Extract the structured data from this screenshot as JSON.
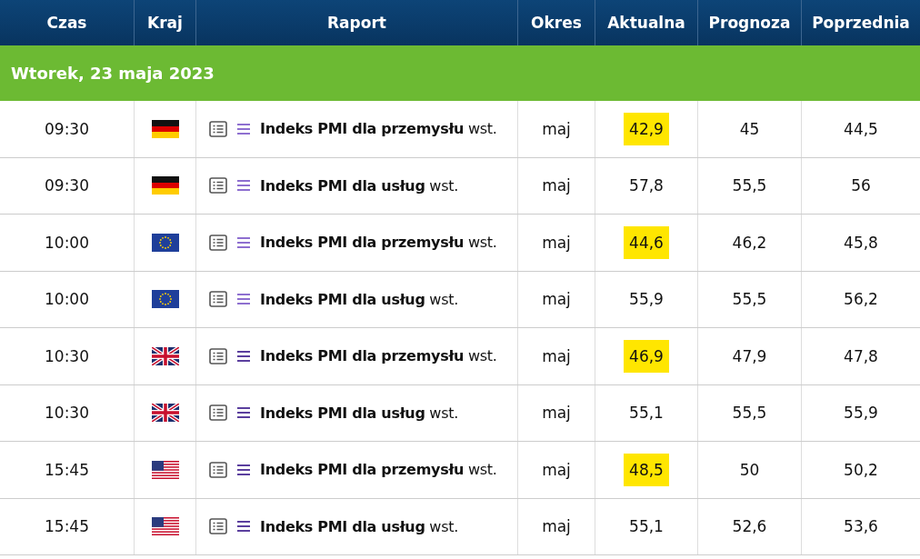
{
  "table": {
    "columns": [
      "Czas",
      "Kraj",
      "Raport",
      "Okres",
      "Aktualna",
      "Prognoza",
      "Poprzednia"
    ],
    "group_label": "Wtorek, 23 maja 2023",
    "rows": [
      {
        "time": "09:30",
        "kind": "de",
        "report": "**Indeks PMI dla przemysłu** wst.",
        "color": "#8e6fd0",
        "period": "maj",
        "actual": "42,9",
        "highlighted": true,
        "forecast": "45",
        "previous": "44,5"
      },
      {
        "time": "09:30",
        "kind": "de",
        "report": "**Indeks PMI dla usług** wst.",
        "color": "#8e6fd0",
        "period": "maj",
        "actual": "57,8",
        "highlighted": false,
        "forecast": "55,5",
        "previous": "56"
      },
      {
        "time": "10:00",
        "kind": "eu",
        "report": "**Indeks PMI dla przemysłu** wst.",
        "color": "#8e6fd0",
        "period": "maj",
        "actual": "44,6",
        "highlighted": true,
        "forecast": "46,2",
        "previous": "45,8"
      },
      {
        "time": "10:00",
        "kind": "eu",
        "report": "**Indeks PMI dla usług** wst.",
        "color": "#8e6fd0",
        "period": "maj",
        "actual": "55,9",
        "highlighted": false,
        "forecast": "55,5",
        "previous": "56,2"
      },
      {
        "time": "10:30",
        "kind": "gb",
        "report": "**Indeks PMI dla przemysłu** wst.",
        "color": "#5b3f9e",
        "period": "maj",
        "actual": "46,9",
        "highlighted": true,
        "forecast": "47,9",
        "previous": "47,8"
      },
      {
        "time": "10:30",
        "kind": "gb",
        "report": "**Indeks PMI dla usług** wst.",
        "color": "#5b3f9e",
        "period": "maj",
        "actual": "55,1",
        "highlighted": false,
        "forecast": "55,5",
        "previous": "55,9"
      },
      {
        "time": "15:45",
        "kind": "us",
        "report": "**Indeks PMI dla przemysłu** wst.",
        "color": "#5b3f9e",
        "period": "maj",
        "actual": "48,5",
        "highlighted": true,
        "forecast": "50",
        "previous": "50,2"
      },
      {
        "time": "15:45",
        "kind": "us",
        "report": "**Indeks PMI dla usług** wst.",
        "color": "#5b3f9e",
        "period": "maj",
        "actual": "55,1",
        "highlighted": false,
        "forecast": "52,6",
        "previous": "53,6"
      }
    ]
  }
}
